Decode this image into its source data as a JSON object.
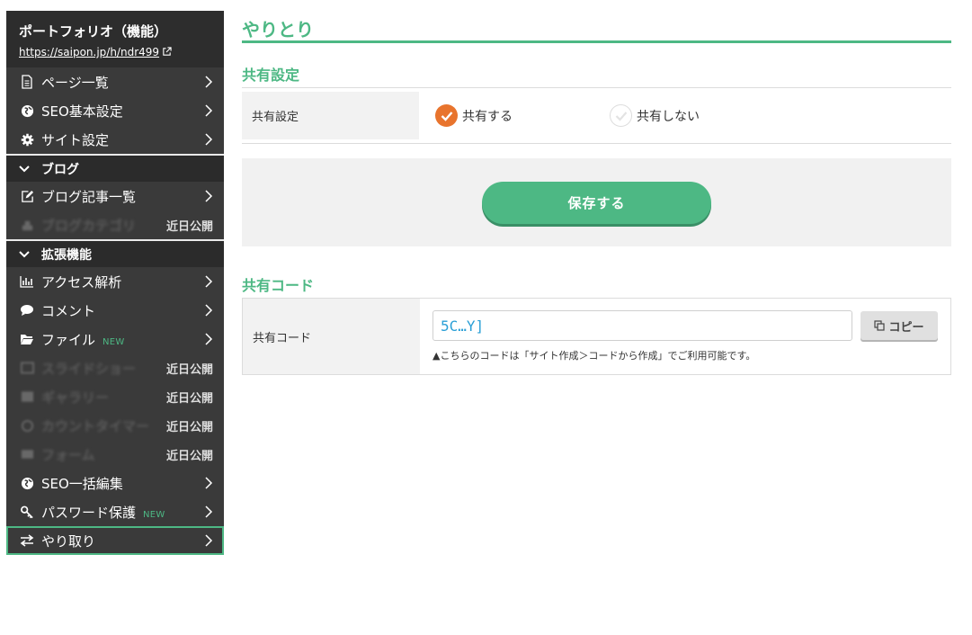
{
  "site": {
    "title": "ポートフォリオ（機能）",
    "url": "https://saipon.jp/h/ndr499"
  },
  "sidebar": {
    "items_top": [
      {
        "icon": "document-icon",
        "label": "ページ一覧"
      },
      {
        "icon": "globe-icon",
        "label": "SEO基本設定"
      },
      {
        "icon": "gear-icon",
        "label": "サイト設定"
      }
    ],
    "section_blog": "ブログ",
    "blog_items": [
      {
        "icon": "edit-icon",
        "label": "ブログ記事一覧"
      }
    ],
    "blog_soon": {
      "label": "ブログカテゴリ",
      "tag": "近日公開"
    },
    "section_ext": "拡張機能",
    "ext_items": [
      {
        "icon": "chart-icon",
        "label": "アクセス解析"
      },
      {
        "icon": "comment-icon",
        "label": "コメント"
      },
      {
        "icon": "folder-icon",
        "label": "ファイル",
        "badge": "NEW"
      }
    ],
    "ext_soon": [
      {
        "label": "スライドショー",
        "tag": "近日公開"
      },
      {
        "label": "ギャラリー",
        "tag": "近日公開"
      },
      {
        "label": "カウントタイマー",
        "tag": "近日公開"
      },
      {
        "label": "フォーム",
        "tag": "近日公開"
      }
    ],
    "ext_items2": [
      {
        "icon": "globe-icon",
        "label": "SEO一括編集"
      },
      {
        "icon": "key-icon",
        "label": "パスワード保護",
        "badge": "NEW"
      },
      {
        "icon": "exchange-icon",
        "label": "やり取り"
      }
    ]
  },
  "main": {
    "page_title": "やりとり",
    "share_section_title": "共有設定",
    "share_label": "共有設定",
    "radio_on": "共有する",
    "radio_off": "共有しない",
    "save_label": "保存する",
    "code_section_title": "共有コード",
    "code_label": "共有コード",
    "code_value": "5C…Y]",
    "copy_label": "コピー",
    "note": "▲こちらのコードは「サイト作成＞コードから作成」でご利用可能です。"
  },
  "colors": {
    "accent": "#4db884",
    "radio_on": "#e8742d",
    "sidebar_bg": "#3a3a3a"
  }
}
